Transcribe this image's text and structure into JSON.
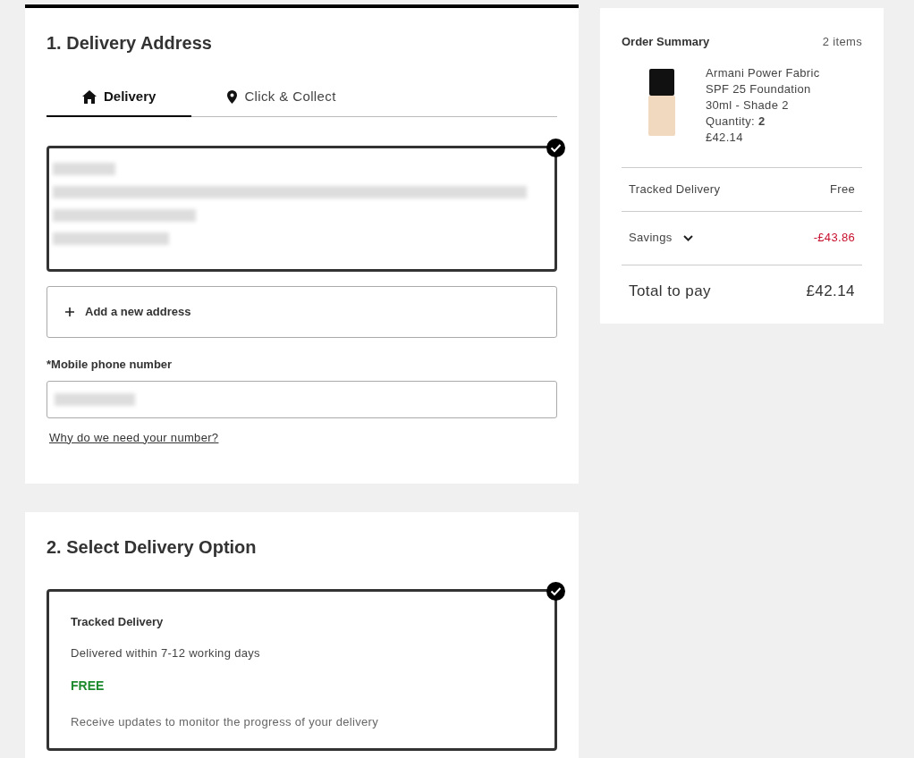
{
  "delivery_address": {
    "title": "1. Delivery Address",
    "tabs": [
      {
        "label": "Delivery",
        "selected": true
      },
      {
        "label": "Click & Collect",
        "selected": false
      }
    ],
    "address_card": {
      "selected": true
    },
    "add_address": "Add a new address",
    "phone": {
      "label": "*Mobile phone number"
    },
    "help_link": "Why do we need your number?"
  },
  "delivery_option": {
    "title": "2. Select Delivery Option",
    "options": [
      {
        "name": "Tracked Delivery",
        "timing": "Delivered within 7-12 working days",
        "price": "FREE",
        "note": "Receive updates to monitor the progress of your delivery",
        "selected": true
      }
    ]
  },
  "order_summary": {
    "title": "Order Summary",
    "count": "2 items",
    "item": {
      "name": "Armani Power Fabric SPF 25 Foundation 30ml - Shade 2",
      "quantity": "Quantity: **2**",
      "price": "£42.14"
    },
    "rows": [
      {
        "kind": "plain",
        "label": "Tracked Delivery",
        "value": "Free"
      },
      {
        "kind": "savings",
        "label": "Savings",
        "value": "-£43.86",
        "expanded": false
      },
      {
        "kind": "total",
        "label": "Total to pay",
        "value": "£42.14"
      }
    ]
  }
}
